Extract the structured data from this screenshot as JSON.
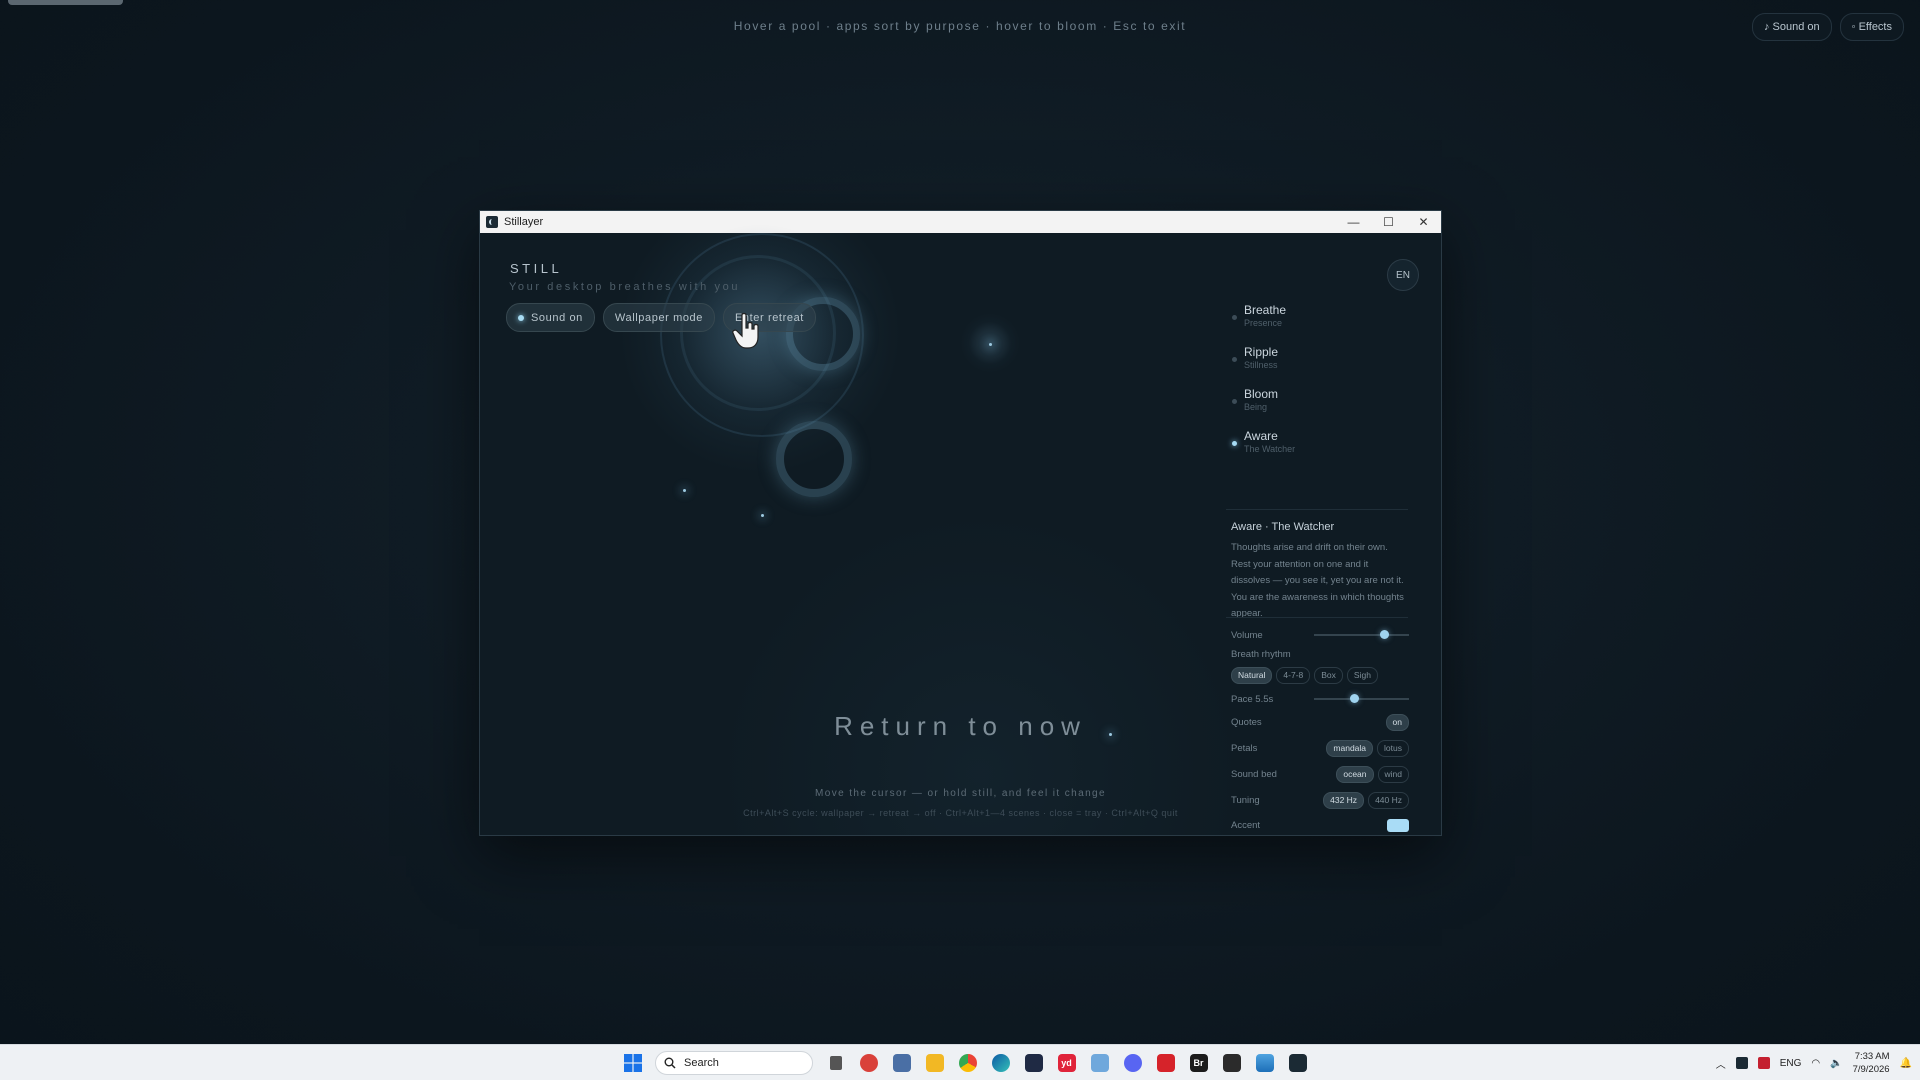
{
  "overlay": {
    "hint": "Hover a pool · apps sort by purpose · hover to bloom · Esc to exit",
    "sound_label": "♪ Sound on",
    "effects_label": "◦ Effects"
  },
  "window": {
    "title": "Stillayer",
    "minimize_glyph": "—",
    "maximize_glyph": "☐",
    "close_glyph": "✕"
  },
  "app": {
    "brand": "STILL",
    "tagline": "Your desktop breathes with you",
    "sound_button": "Sound on",
    "wallpaper_button": "Wallpaper mode",
    "retreat_button": "Enter retreat",
    "lang": "EN",
    "return_text": "Return to now",
    "hint_primary": "Move the cursor — or hold still, and feel it change",
    "hint_shortcuts": "Ctrl+Alt+S cycle: wallpaper → retreat → off · Ctrl+Alt+1—4 scenes · close = tray · Ctrl+Alt+Q quit"
  },
  "scenes": [
    {
      "name": "Breathe",
      "sub": "Presence",
      "active": false
    },
    {
      "name": "Ripple",
      "sub": "Stillness",
      "active": false
    },
    {
      "name": "Bloom",
      "sub": "Being",
      "active": false
    },
    {
      "name": "Aware",
      "sub": "The Watcher",
      "active": true
    }
  ],
  "description": {
    "title": "Aware · The Watcher",
    "body": "Thoughts arise and drift on their own. Rest your attention on one and it dissolves — you see it, yet you are not it. You are the awareness in which thoughts appear."
  },
  "controls": {
    "volume_label": "Volume",
    "volume_value": 0.74,
    "breath_label": "Breath rhythm",
    "breath_options": [
      "Natural",
      "4-7-8",
      "Box",
      "Sigh"
    ],
    "breath_selected": "Natural",
    "pace_label": "Pace 5.5s",
    "pace_value": 0.42,
    "quotes_label": "Quotes",
    "quotes_value": "on",
    "petals_label": "Petals",
    "petals_options": [
      "mandala",
      "lotus"
    ],
    "petals_selected": "mandala",
    "soundbed_label": "Sound bed",
    "soundbed_options": [
      "ocean",
      "wind"
    ],
    "soundbed_selected": "ocean",
    "tuning_label": "Tuning",
    "tuning_options": [
      "432 Hz",
      "440 Hz"
    ],
    "tuning_selected": "432 Hz",
    "accent_label": "Accent",
    "accent_color": "#a9dcf6"
  },
  "taskbar": {
    "search_placeholder": "Search",
    "lang": "ENG",
    "time": "7:33 AM",
    "date": "7/9/2026"
  }
}
